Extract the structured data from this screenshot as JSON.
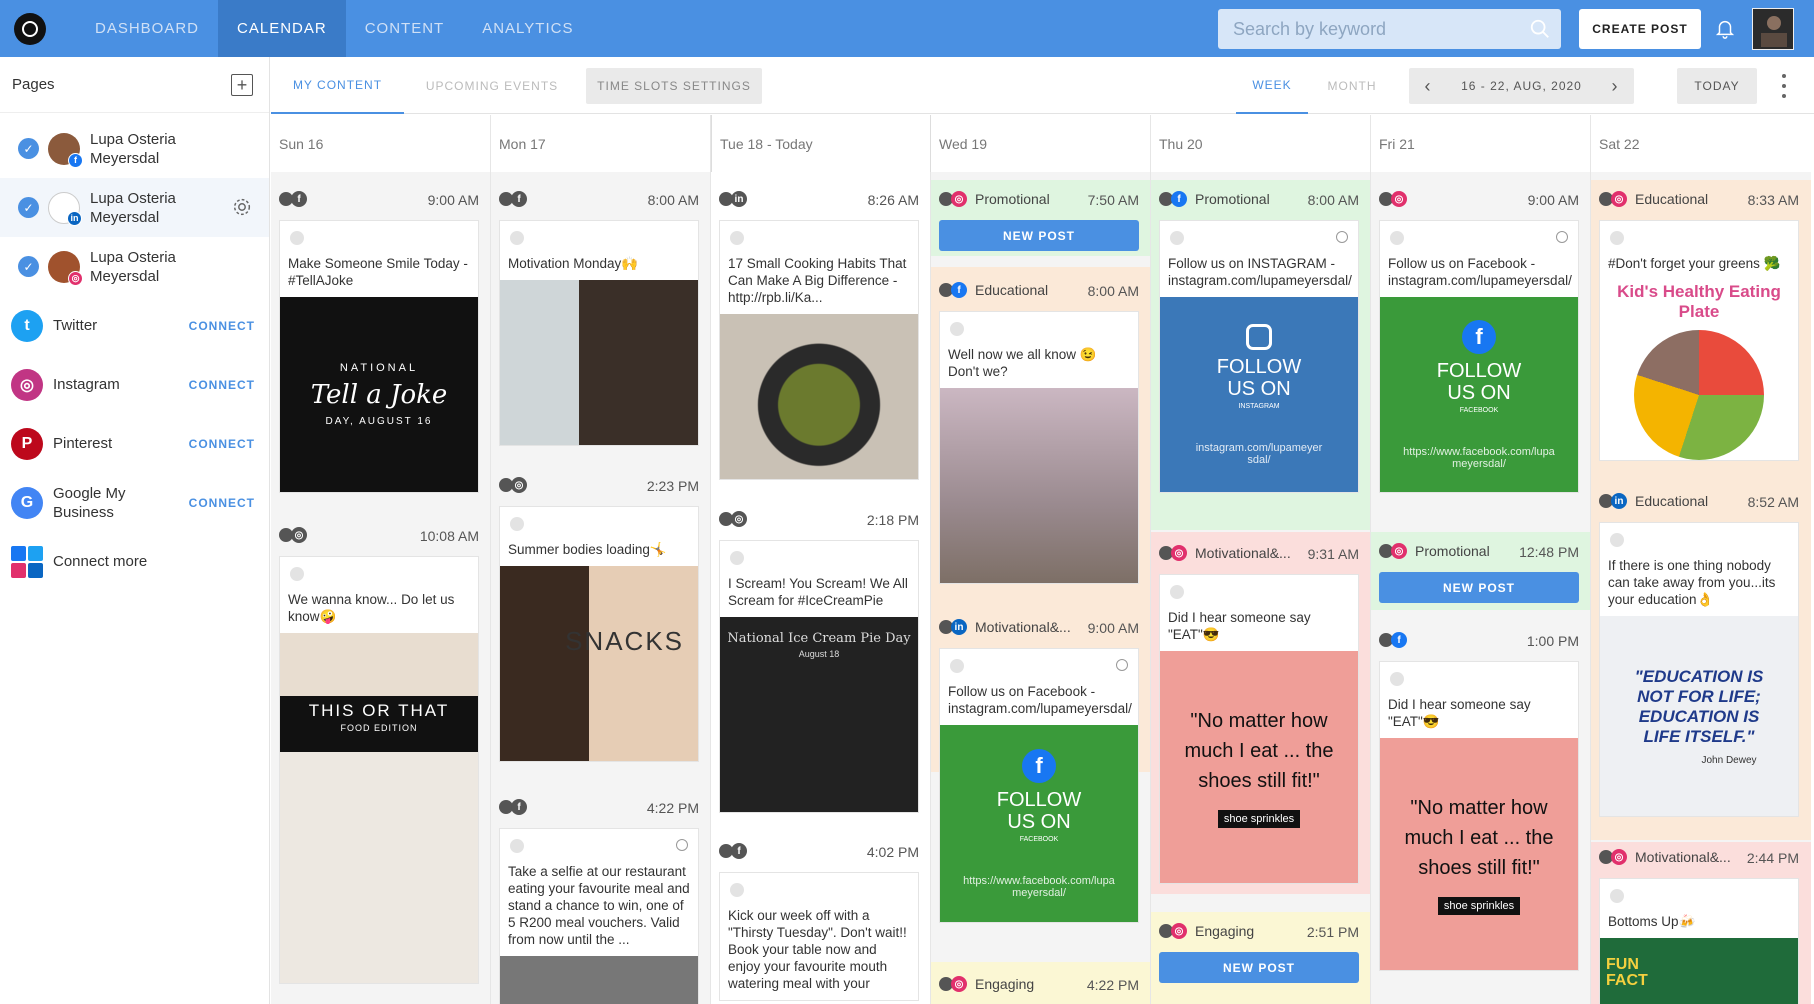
{
  "nav": {
    "items": [
      "DASHBOARD",
      "CALENDAR",
      "CONTENT",
      "ANALYTICS"
    ],
    "active": "CALENDAR"
  },
  "search": {
    "placeholder": "Search by keyword"
  },
  "create_post": "CREATE POST",
  "sidebar": {
    "title": "Pages",
    "pages": [
      {
        "name": "Lupa Osteria Meyersdal",
        "network": "facebook"
      },
      {
        "name": "Lupa Osteria Meyersdal",
        "network": "linkedin"
      },
      {
        "name": "Lupa Osteria Meyersdal",
        "network": "instagram"
      }
    ],
    "socials": [
      {
        "name": "Twitter",
        "action": "CONNECT",
        "color": "#1da1f2",
        "icon": "twitter-icon"
      },
      {
        "name": "Instagram",
        "action": "CONNECT",
        "color": "#c13584",
        "icon": "instagram-icon"
      },
      {
        "name": "Pinterest",
        "action": "CONNECT",
        "color": "#bd081c",
        "icon": "pinterest-icon"
      },
      {
        "name": "Google My Business",
        "action": "CONNECT",
        "color": "#4285f4",
        "icon": "google-icon"
      }
    ],
    "connect_more": "Connect more"
  },
  "toolbar": {
    "tabs": [
      "MY CONTENT",
      "UPCOMING EVENTS"
    ],
    "time_slots": "TIME SLOTS SETTINGS",
    "views": [
      "WEEK",
      "MONTH"
    ],
    "range": "16 - 22, AUG, 2020",
    "today": "TODAY"
  },
  "days": [
    "Sun 16",
    "Mon 17",
    "Tue 18 - Today",
    "Wed 19",
    "Thu 20",
    "Fri 21",
    "Sat 22"
  ],
  "posts": {
    "sun": [
      {
        "time": "9:00 AM",
        "text": "Make Someone Smile Today - #TellAJoke",
        "img_title": "Tell a Joke",
        "img_sub": "DAY, AUGUST 16",
        "img_top": "NATIONAL"
      },
      {
        "time": "10:08 AM",
        "text": "We wanna know... Do let us know🤪",
        "img_title": "THIS OR THAT",
        "img_sub": "FOOD EDITION"
      }
    ],
    "mon": [
      {
        "time": "8:00 AM",
        "text": "Motivation Monday🙌"
      },
      {
        "time": "2:23 PM",
        "text": "Summer bodies loading🤸",
        "img_title": "SNACKS"
      },
      {
        "time": "4:22 PM",
        "text": "Take a selfie at our restaurant eating your favourite meal and stand a chance to win, one of 5 R200 meal vouchers. Valid from now until the ..."
      }
    ],
    "tue": [
      {
        "time": "8:26 AM",
        "text": "17 Small Cooking Habits That Can Make A Big Difference - http://rpb.li/Ka..."
      },
      {
        "time": "2:18 PM",
        "text": "I Scream! You Scream! We All Scream for #IceCreamPie",
        "img_title": "National Ice Cream Pie Day",
        "img_sub": "August 18"
      },
      {
        "time": "4:02 PM",
        "text": "Kick our week off with a \"Thirsty Tuesday\". Don't wait!! Book your table now and enjoy your favourite mouth watering meal with your"
      }
    ],
    "wed": [
      {
        "time": "7:50 AM",
        "category": "Promotional",
        "new_post": "NEW POST"
      },
      {
        "time": "8:00 AM",
        "category": "Educational",
        "text": "Well now we all know 😉 Don't we?"
      },
      {
        "time": "9:00 AM",
        "category": "Motivational&...",
        "text": "Follow us on Facebook - instagram.com/lupameyersdal/",
        "img_title": "FOLLOW US ON",
        "img_sub": "FACEBOOK",
        "img_url": "https://www.facebook.com/lupameyersdal/"
      },
      {
        "time": "4:22 PM",
        "category": "Engaging"
      }
    ],
    "thu": [
      {
        "time": "8:00 AM",
        "category": "Promotional",
        "text": "Follow us on INSTAGRAM - instagram.com/lupameyersdal/",
        "img_title": "FOLLOW US ON",
        "img_sub": "INSTAGRAM",
        "img_url": "instagram.com/lupameyersdal/"
      },
      {
        "time": "9:31 AM",
        "category": "Motivational&...",
        "text": "Did I hear someone say \"EAT\"😎",
        "img_quote": "\"No matter how much I eat ... the shoes still fit!\"",
        "img_tag": "shoe sprinkles"
      },
      {
        "time": "2:51 PM",
        "category": "Engaging",
        "new_post": "NEW POST"
      }
    ],
    "fri": [
      {
        "time": "9:00 AM",
        "text": "Follow us on Facebook - instagram.com/lupameyersdal/",
        "img_title": "FOLLOW US ON",
        "img_sub": "FACEBOOK",
        "img_url": "https://www.facebook.com/lupameyersdal/"
      },
      {
        "time": "12:48 PM",
        "category": "Promotional",
        "new_post": "NEW POST"
      },
      {
        "time": "1:00 PM",
        "text": "Did I hear someone say \"EAT\"😎",
        "img_quote": "\"No matter how much I eat ... the shoes still fit!\"",
        "img_tag": "shoe sprinkles"
      }
    ],
    "sat": [
      {
        "time": "8:33 AM",
        "category": "Educational",
        "text": "#Don't forget your greens 🥦",
        "img_title": "Kid's Healthy Eating Plate"
      },
      {
        "time": "8:52 AM",
        "category": "Educational",
        "text": "If there is one thing nobody can take away from you...its your education👌",
        "img_title": "\"EDUCATION IS NOT FOR LIFE; EDUCATION IS LIFE ITSELF.\"",
        "img_sub": "John Dewey"
      },
      {
        "time": "2:44 PM",
        "category": "Motivational&...",
        "text": "Bottoms Up🍻",
        "img_title": "FUN FACT"
      }
    ]
  },
  "colors": {
    "accent": "#4a90e2",
    "header": "#4a90e2",
    "nav_active": "#3a7bc8"
  }
}
